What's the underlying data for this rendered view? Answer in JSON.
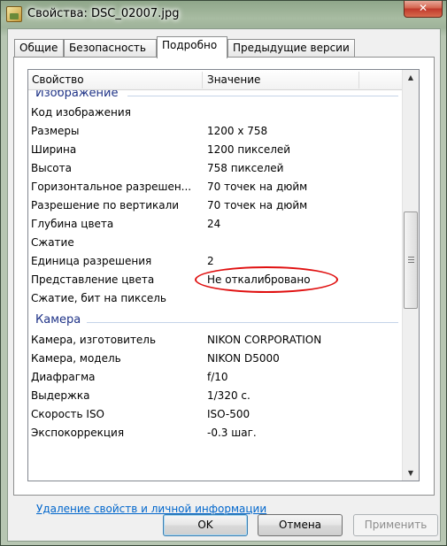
{
  "window": {
    "title": "Свойства: DSC_02007.jpg",
    "close_label": "✕"
  },
  "tabs": [
    {
      "label": "Общие",
      "active": false
    },
    {
      "label": "Безопасность",
      "active": false
    },
    {
      "label": "Подробно",
      "active": true
    },
    {
      "label": "Предыдущие версии",
      "active": false
    }
  ],
  "list": {
    "col_property": "Свойство",
    "col_value": "Значение",
    "groups": {
      "image": "Изображение",
      "camera": "Камера"
    },
    "image_rows": [
      {
        "prop": "Код изображения",
        "val": ""
      },
      {
        "prop": "Размеры",
        "val": "1200 x 758"
      },
      {
        "prop": "Ширина",
        "val": "1200 пикселей"
      },
      {
        "prop": "Высота",
        "val": "758 пикселей"
      },
      {
        "prop": "Горизонтальное разрешен...",
        "val": "70 точек на дюйм"
      },
      {
        "prop": "Разрешение по вертикали",
        "val": "70 точек на дюйм"
      },
      {
        "prop": "Глубина цвета",
        "val": "24"
      },
      {
        "prop": "Сжатие",
        "val": ""
      },
      {
        "prop": "Единица разрешения",
        "val": "2"
      },
      {
        "prop": "Представление цвета",
        "val": "Не откалибровано"
      },
      {
        "prop": "Сжатие, бит на пиксель",
        "val": ""
      }
    ],
    "camera_rows": [
      {
        "prop": "Камера, изготовитель",
        "val": "NIKON CORPORATION"
      },
      {
        "prop": "Камера, модель",
        "val": "NIKON D5000"
      },
      {
        "prop": "Диафрагма",
        "val": "f/10"
      },
      {
        "prop": "Выдержка",
        "val": "1/320 с."
      },
      {
        "prop": "Скорость ISO",
        "val": "ISO-500"
      },
      {
        "prop": "Экспокоррекция",
        "val": "-0.3 шаг."
      }
    ]
  },
  "link": "Удаление свойств и личной информации",
  "buttons": {
    "ok": "OK",
    "cancel": "Отмена",
    "apply": "Применить"
  },
  "colors": {
    "group_label": "#1e3287",
    "link": "#0066cc",
    "annotation": "#e01010"
  }
}
